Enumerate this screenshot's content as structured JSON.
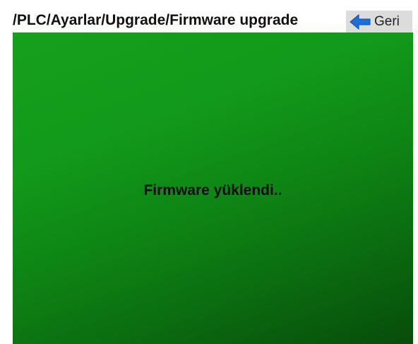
{
  "header": {
    "breadcrumb": "/PLC/Ayarlar/Upgrade/Firmware upgrade",
    "back_label": "Geri"
  },
  "icons": {
    "back": "arrow-left-icon"
  },
  "colors": {
    "panel_green": "#129a1a",
    "panel_dark_green": "#074c0b",
    "back_arrow": "#1e6fd9",
    "button_bg": "#dcdcdc"
  },
  "main": {
    "status_message": "Firmware yüklendi.."
  }
}
